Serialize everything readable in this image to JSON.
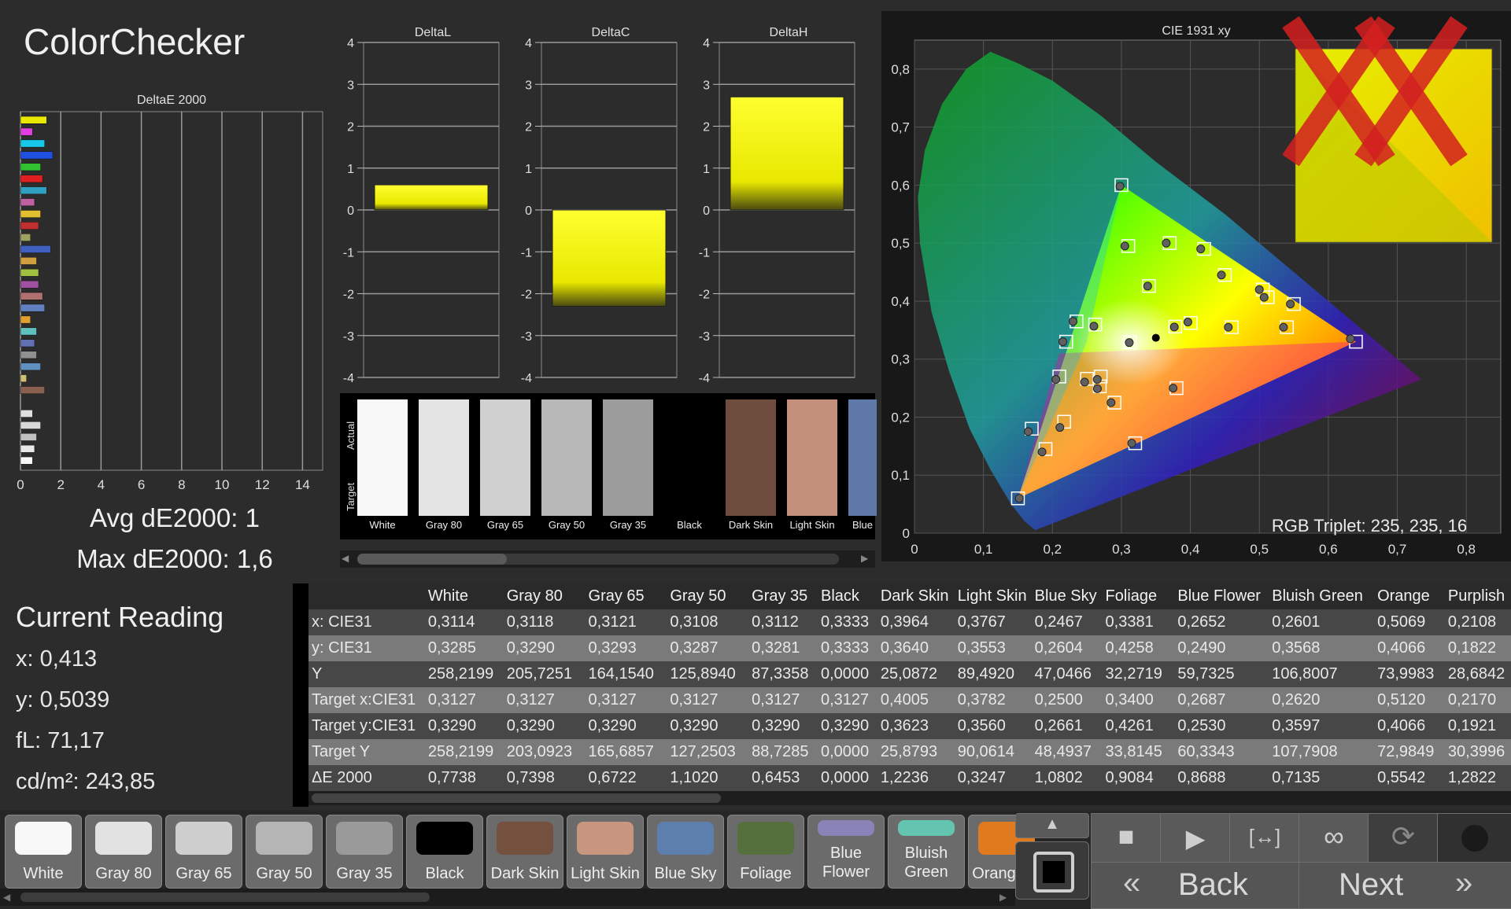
{
  "title": "ColorChecker",
  "avg_label": "Avg dE2000: 1",
  "max_label": "Max dE2000: 1,6",
  "current_reading": {
    "title": "Current Reading",
    "x": "x: 0,413",
    "y": "y: 0,5039",
    "fl": "fL: 71,17",
    "cdm2": "cd/m²: 243,85"
  },
  "swatch_strip": {
    "actual_label": "Actual",
    "target_label": "Target",
    "items": [
      {
        "label": "White",
        "color": "#f8f8f8"
      },
      {
        "label": "Gray 80",
        "color": "#e4e4e4"
      },
      {
        "label": "Gray 65",
        "color": "#d0d0d0"
      },
      {
        "label": "Gray 50",
        "color": "#b8b8b8"
      },
      {
        "label": "Gray 35",
        "color": "#9c9c9c"
      },
      {
        "label": "Black",
        "color": "#000000"
      },
      {
        "label": "Dark Skin",
        "color": "#6e4c3e"
      },
      {
        "label": "Light Skin",
        "color": "#c3907c"
      },
      {
        "label": "Blue",
        "color": "#5f7aa8"
      }
    ]
  },
  "table": {
    "columns": [
      "White",
      "Gray 80",
      "Gray 65",
      "Gray 50",
      "Gray 35",
      "Black",
      "Dark Skin",
      "Light Skin",
      "Blue Sky",
      "Foliage",
      "Blue Flower",
      "Bluish Green",
      "Orange",
      "Purplish"
    ],
    "rows": [
      {
        "label": "x: CIE31",
        "values": [
          "0,3114",
          "0,3118",
          "0,3121",
          "0,3108",
          "0,3112",
          "0,3333",
          "0,3964",
          "0,3767",
          "0,2467",
          "0,3381",
          "0,2652",
          "0,2601",
          "0,5069",
          "0,2108"
        ]
      },
      {
        "label": "y: CIE31",
        "values": [
          "0,3285",
          "0,3290",
          "0,3293",
          "0,3287",
          "0,3281",
          "0,3333",
          "0,3640",
          "0,3553",
          "0,2604",
          "0,4258",
          "0,2490",
          "0,3568",
          "0,4066",
          "0,1822"
        ]
      },
      {
        "label": "Y",
        "values": [
          "258,2199",
          "205,7251",
          "164,1540",
          "125,8940",
          "87,3358",
          "0,0000",
          "25,0872",
          "89,4920",
          "47,0466",
          "32,2719",
          "59,7325",
          "106,8007",
          "73,9983",
          "28,6842"
        ]
      },
      {
        "label": "Target x:CIE31",
        "values": [
          "0,3127",
          "0,3127",
          "0,3127",
          "0,3127",
          "0,3127",
          "0,3127",
          "0,4005",
          "0,3782",
          "0,2500",
          "0,3400",
          "0,2687",
          "0,2620",
          "0,5120",
          "0,2170"
        ]
      },
      {
        "label": "Target y:CIE31",
        "values": [
          "0,3290",
          "0,3290",
          "0,3290",
          "0,3290",
          "0,3290",
          "0,3290",
          "0,3623",
          "0,3560",
          "0,2661",
          "0,4261",
          "0,2530",
          "0,3597",
          "0,4066",
          "0,1921"
        ]
      },
      {
        "label": "Target Y",
        "values": [
          "258,2199",
          "203,0923",
          "165,6857",
          "127,2503",
          "88,7285",
          "0,0000",
          "25,8793",
          "90,0614",
          "48,4937",
          "33,8145",
          "60,3343",
          "107,7908",
          "72,9849",
          "30,3996"
        ]
      },
      {
        "label": "ΔE 2000",
        "values": [
          "0,7738",
          "0,7398",
          "0,6722",
          "1,1020",
          "0,6453",
          "0,0000",
          "1,2236",
          "0,3247",
          "1,0802",
          "0,9084",
          "0,8688",
          "0,7135",
          "0,5542",
          "1,2822"
        ]
      }
    ]
  },
  "bottom_swatches": [
    {
      "label": "White",
      "color": "#f8f8f8"
    },
    {
      "label": "Gray 80",
      "color": "#e2e2e2"
    },
    {
      "label": "Gray 65",
      "color": "#cfcfcf"
    },
    {
      "label": "Gray 50",
      "color": "#b5b5b5"
    },
    {
      "label": "Gray 35",
      "color": "#9a9a9a"
    },
    {
      "label": "Black",
      "color": "#000000"
    },
    {
      "label": "Dark Skin",
      "color": "#74503f"
    },
    {
      "label": "Light Skin",
      "color": "#c9977f"
    },
    {
      "label": "Blue Sky",
      "color": "#5d7fad"
    },
    {
      "label": "Foliage",
      "color": "#55703c"
    },
    {
      "label": "Blue\nFlower",
      "color": "#8a83b8"
    },
    {
      "label": "Bluish\nGreen",
      "color": "#63c4b0"
    },
    {
      "label": "Orang",
      "color": "#e07a1e"
    }
  ],
  "nav": {
    "back": "Back",
    "next": "Next"
  },
  "rgb_triplet": "RGB Triplet: 235, 235, 16",
  "chart_data": [
    {
      "type": "bar",
      "title": "DeltaE 2000",
      "orientation": "horizontal",
      "xlim": [
        0,
        15
      ],
      "xticks": [
        "0",
        "2",
        "4",
        "6",
        "8",
        "10",
        "12",
        "14"
      ],
      "values": [
        1.3,
        0.6,
        1.2,
        1.6,
        1.0,
        1.1,
        1.3,
        0.7,
        1.0,
        0.9,
        0.5,
        1.5,
        0.8,
        0.9,
        0.9,
        1.1,
        1.2,
        0.5,
        0.8,
        0.7,
        0.8,
        1.0,
        0.3,
        1.2,
        0,
        0.6,
        1.0,
        0.8,
        0.7,
        0.6
      ],
      "colors": [
        "#e8e800",
        "#e040e0",
        "#18c8e8",
        "#2050e0",
        "#30c030",
        "#e02020",
        "#30a0c0",
        "#c060a0",
        "#e0c030",
        "#c03030",
        "#a0a060",
        "#4060c0",
        "#d0a040",
        "#a0c040",
        "#a050a0",
        "#b07070",
        "#6080c0",
        "#e0a030",
        "#60c0c0",
        "#6070b0",
        "#909090",
        "#6090c0",
        "#d0c070",
        "#8a6050",
        "#2c2c2c",
        "#e0e0e0",
        "#d8d8d8",
        "#c0c0c0",
        "#e8e8e8",
        "#f8f8f8"
      ]
    },
    {
      "type": "bar",
      "title": "DeltaL",
      "ylim": [
        -4,
        4
      ],
      "values": [
        0.6
      ]
    },
    {
      "type": "bar",
      "title": "DeltaC",
      "ylim": [
        -4,
        4
      ],
      "values": [
        -2.3
      ]
    },
    {
      "type": "bar",
      "title": "DeltaH",
      "ylim": [
        -4,
        4
      ],
      "values": [
        2.7
      ]
    },
    {
      "type": "scatter",
      "title": "CIE 1931 xy",
      "xlim": [
        0,
        0.85
      ],
      "ylim": [
        0,
        0.85
      ],
      "xticks": [
        "0",
        "0,1",
        "0,2",
        "0,3",
        "0,4",
        "0,5",
        "0,6",
        "0,7",
        "0,8"
      ],
      "yticks": [
        "0",
        "0,1",
        "0,2",
        "0,3",
        "0,4",
        "0,5",
        "0,6",
        "0,7",
        "0,8"
      ],
      "targets": [
        [
          0.64,
          0.33
        ],
        [
          0.3,
          0.6
        ],
        [
          0.15,
          0.06
        ],
        [
          0.3127,
          0.329
        ],
        [
          0.4005,
          0.3623
        ],
        [
          0.3782,
          0.356
        ],
        [
          0.25,
          0.2661
        ],
        [
          0.34,
          0.4261
        ],
        [
          0.2687,
          0.253
        ],
        [
          0.262,
          0.3597
        ],
        [
          0.512,
          0.4066
        ],
        [
          0.217,
          0.1921
        ],
        [
          0.46,
          0.355
        ],
        [
          0.54,
          0.355
        ],
        [
          0.42,
          0.49
        ],
        [
          0.45,
          0.445
        ],
        [
          0.505,
          0.42
        ],
        [
          0.55,
          0.395
        ],
        [
          0.37,
          0.5
        ],
        [
          0.31,
          0.495
        ],
        [
          0.22,
          0.33
        ],
        [
          0.235,
          0.365
        ],
        [
          0.21,
          0.27
        ],
        [
          0.19,
          0.145
        ],
        [
          0.17,
          0.18
        ],
        [
          0.38,
          0.25
        ],
        [
          0.32,
          0.155
        ],
        [
          0.29,
          0.225
        ],
        [
          0.27,
          0.27
        ]
      ],
      "measured": [
        [
          0.632,
          0.335
        ],
        [
          0.298,
          0.598
        ],
        [
          0.152,
          0.06
        ],
        [
          0.3114,
          0.3285
        ],
        [
          0.3964,
          0.364
        ],
        [
          0.3767,
          0.3553
        ],
        [
          0.2467,
          0.2604
        ],
        [
          0.3381,
          0.4258
        ],
        [
          0.2652,
          0.249
        ],
        [
          0.2601,
          0.3568
        ],
        [
          0.5069,
          0.4066
        ],
        [
          0.2108,
          0.1822
        ],
        [
          0.455,
          0.355
        ],
        [
          0.535,
          0.355
        ],
        [
          0.415,
          0.49
        ],
        [
          0.445,
          0.445
        ],
        [
          0.5,
          0.42
        ],
        [
          0.545,
          0.395
        ],
        [
          0.365,
          0.5
        ],
        [
          0.305,
          0.495
        ],
        [
          0.215,
          0.33
        ],
        [
          0.23,
          0.365
        ],
        [
          0.205,
          0.265
        ],
        [
          0.185,
          0.14
        ],
        [
          0.165,
          0.175
        ],
        [
          0.375,
          0.25
        ],
        [
          0.315,
          0.155
        ],
        [
          0.285,
          0.225
        ],
        [
          0.265,
          0.265
        ]
      ],
      "current": [
        0.334,
        0.334
      ]
    }
  ]
}
